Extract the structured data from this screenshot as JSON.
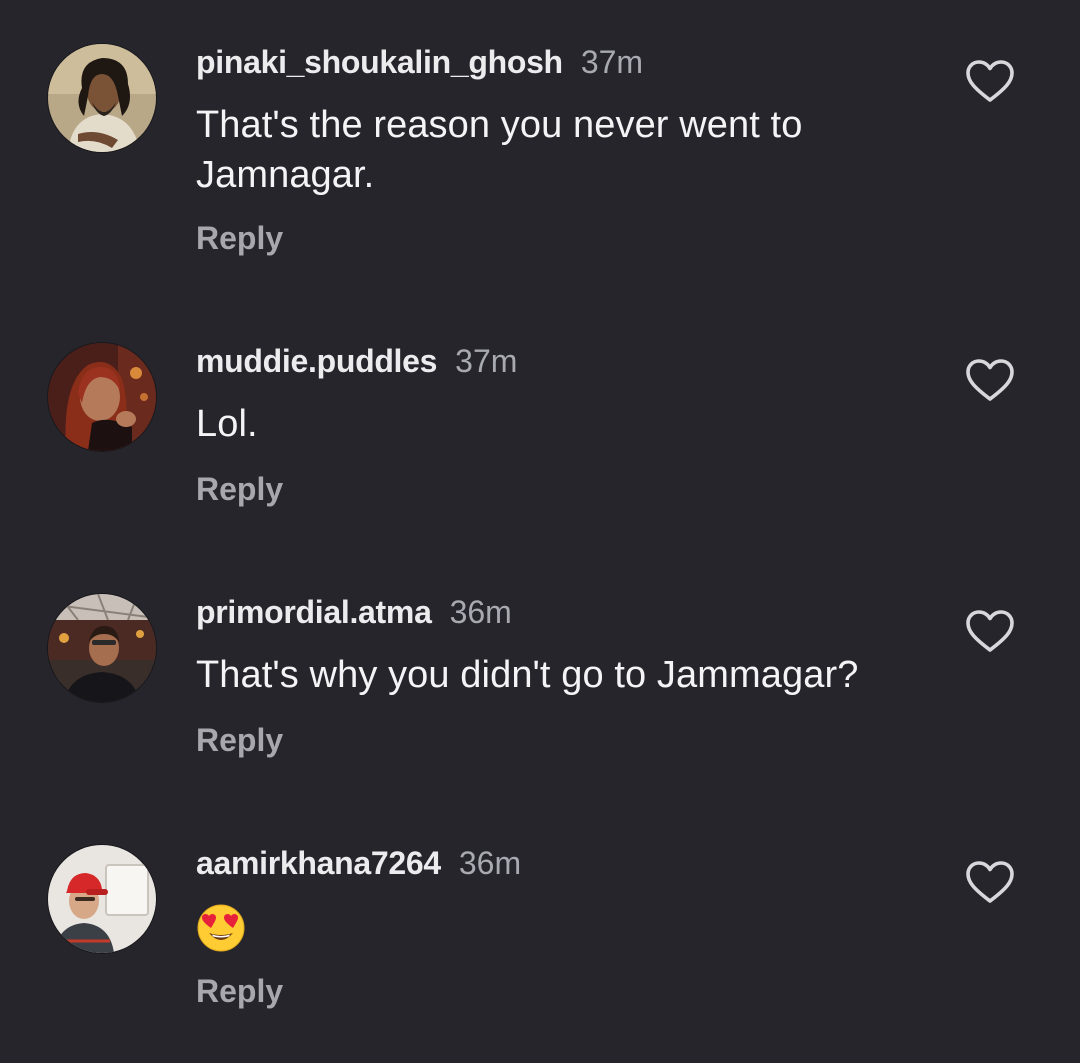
{
  "comments": [
    {
      "username": "pinaki_shoukalin_ghosh",
      "time": "37m",
      "text": "That's the reason you never went to Jamnagar.",
      "reply_label": "Reply",
      "avatar_icon": "person-photo-avatar",
      "like_icon": "heart-outline-icon"
    },
    {
      "username": "muddie.puddles",
      "time": "37m",
      "text": "Lol.",
      "reply_label": "Reply",
      "avatar_icon": "person-photo-avatar",
      "like_icon": "heart-outline-icon"
    },
    {
      "username": "primordial.atma",
      "time": "36m",
      "text": "That's why you didn't go to Jammagar?",
      "reply_label": "Reply",
      "avatar_icon": "person-photo-avatar",
      "like_icon": "heart-outline-icon"
    },
    {
      "username": "aamirkhana7264",
      "time": "36m",
      "text": "",
      "text_emoji": "smiling-face-with-heart-eyes",
      "reply_label": "Reply",
      "avatar_icon": "person-photo-avatar",
      "like_icon": "heart-outline-icon"
    }
  ],
  "colors": {
    "background": "#25252b",
    "username": "#ececef",
    "time": "#a9a9b1",
    "text": "#f4f4f6",
    "reply": "#a7a7ad",
    "heart_outline": "#d8d8dc"
  }
}
